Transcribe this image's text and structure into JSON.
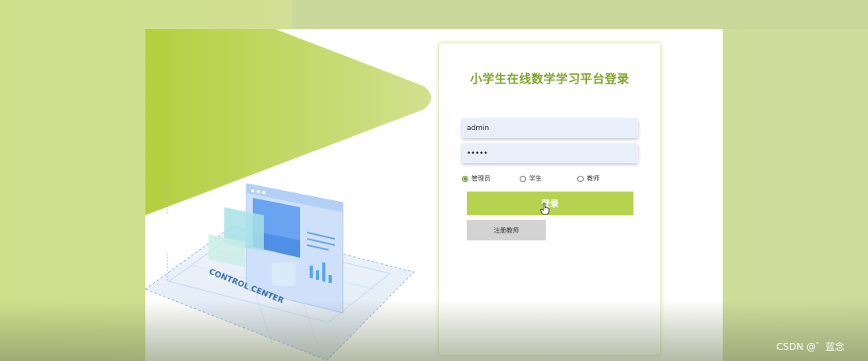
{
  "login": {
    "title": "小学生在线数学学习平台登录",
    "username": {
      "value": "admin"
    },
    "password": {
      "value": "•••••"
    },
    "roles": [
      {
        "label": "管理员",
        "checked": true
      },
      {
        "label": "学生",
        "checked": false
      },
      {
        "label": "教师",
        "checked": false
      }
    ],
    "login_label": "登录",
    "register_label": "注册教师"
  },
  "illustration": {
    "caption": "CONTROL CENTER"
  },
  "watermark": "CSDN @゛蓝念",
  "colors": {
    "accent": "#b6d34f",
    "title": "#7fa528",
    "background": "#cfdd95",
    "input_bg": "#e7effb"
  }
}
